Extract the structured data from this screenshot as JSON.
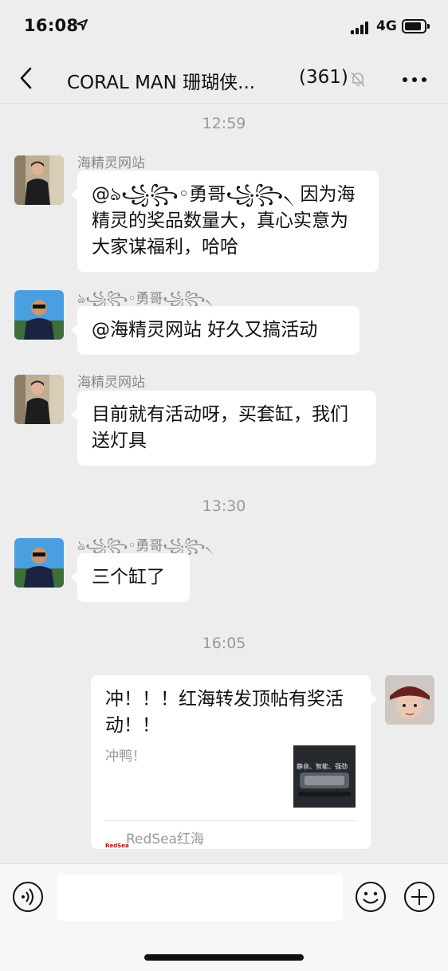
{
  "status_bar": {
    "time": "16:08",
    "network": "4G"
  },
  "nav": {
    "title": "CORAL MAN 珊瑚侠...",
    "member_count": "(361)"
  },
  "chat": {
    "timestamps": [
      "12:59",
      "13:30",
      "16:05"
    ],
    "messages": [
      {
        "sender": "海精灵网站",
        "text": "@ঌ꧁꧂◦勇哥꧁꧂৲ 因为海精灵的奖品数量大，真心实意为大家谋福利，哈哈"
      },
      {
        "sender": "ঌ꧁꧂◦勇哥꧁꧂৲",
        "text": "@海精灵网站 好久又搞活动"
      },
      {
        "sender": "海精灵网站",
        "text": "目前就有活动呀，买套缸，我们送灯具"
      },
      {
        "sender": "ঌ꧁꧂◦勇哥꧁꧂৲",
        "text": "三个缸了"
      }
    ],
    "card": {
      "title": "冲！！！红海转发顶帖有奖活动！！",
      "description": "冲鸭！",
      "thumb_text": "静音、智能、强劲",
      "source_logo": "RedSea",
      "source": "RedSea红海"
    }
  },
  "colors": {
    "background": "#ededed",
    "bubble": "#ffffff",
    "muted_text": "#9a9a9a"
  }
}
